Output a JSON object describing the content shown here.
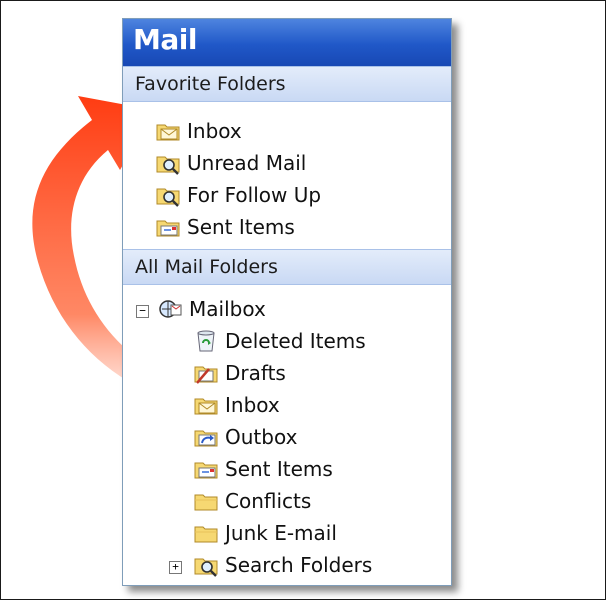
{
  "pane": {
    "title": "Mail"
  },
  "favorites": {
    "header": "Favorite Folders",
    "items": [
      {
        "label": "Inbox",
        "icon": "inbox-folder-icon"
      },
      {
        "label": "Unread Mail",
        "icon": "search-folder-icon"
      },
      {
        "label": "For Follow Up",
        "icon": "search-folder-icon"
      },
      {
        "label": "Sent Items",
        "icon": "sent-items-icon"
      }
    ]
  },
  "all_folders": {
    "header": "All Mail Folders",
    "mailbox": {
      "label": "Mailbox",
      "expander": "⊟",
      "icon": "mailbox-icon"
    },
    "items": [
      {
        "label": "Deleted Items",
        "icon": "recycle-bin-icon"
      },
      {
        "label": "Drafts",
        "icon": "drafts-icon"
      },
      {
        "label": "Inbox",
        "icon": "inbox-folder-icon"
      },
      {
        "label": "Outbox",
        "icon": "outbox-icon"
      },
      {
        "label": "Sent Items",
        "icon": "sent-items-icon"
      },
      {
        "label": "Conflicts",
        "icon": "folder-icon"
      },
      {
        "label": "Junk E-mail",
        "icon": "folder-icon"
      },
      {
        "label": "Search Folders",
        "icon": "search-folder-icon",
        "expander": "+"
      }
    ]
  },
  "colors": {
    "header_blue": "#2058c8",
    "annotation_red": "#e8321a",
    "folder_yellow": "#f6d872"
  }
}
